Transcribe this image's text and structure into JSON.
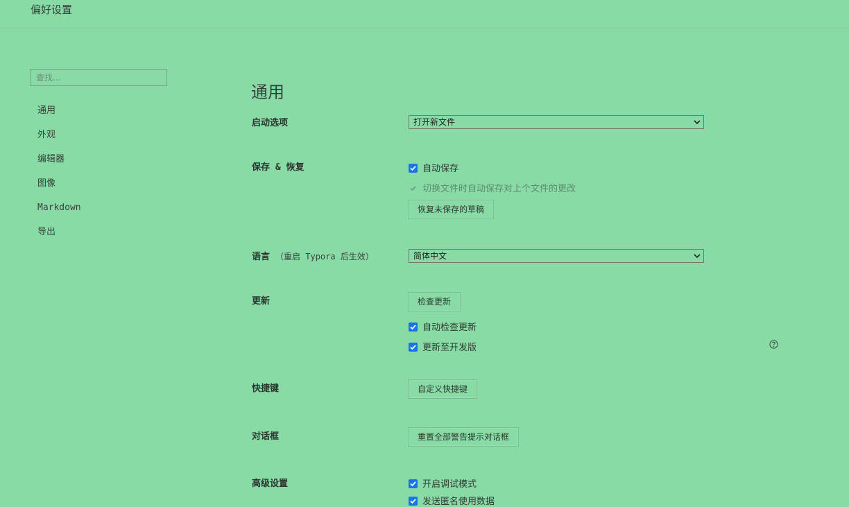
{
  "window": {
    "title": "偏好设置"
  },
  "sidebar": {
    "search_placeholder": "查找...",
    "items": [
      {
        "label": "通用"
      },
      {
        "label": "外观"
      },
      {
        "label": "编辑器"
      },
      {
        "label": "图像"
      },
      {
        "label": "Markdown"
      },
      {
        "label": "导出"
      }
    ]
  },
  "main": {
    "title": "通用",
    "startup": {
      "label": "启动选项",
      "value": "打开新文件"
    },
    "save": {
      "label": "保存 & 恢复",
      "autosave": {
        "label": "自动保存",
        "checked": true
      },
      "switch_save": {
        "label": "切换文件时自动保存对上个文件的更改",
        "checked": true,
        "disabled": true
      },
      "recover_button": "恢复未保存的草稿"
    },
    "language": {
      "label": "语言",
      "note": "（重启 Typora 后生效）",
      "value": "简体中文"
    },
    "update": {
      "label": "更新",
      "check_button": "检查更新",
      "auto_check": {
        "label": "自动检查更新",
        "checked": true
      },
      "dev_channel": {
        "label": "更新至开发版",
        "checked": true
      }
    },
    "shortcuts": {
      "label": "快捷键",
      "button": "自定义快捷键"
    },
    "dialogs": {
      "label": "对话框",
      "button": "重置全部警告提示对话框"
    },
    "advanced": {
      "label": "高级设置",
      "debug_mode": {
        "label": "开启调试模式",
        "checked": true
      },
      "anonymous_data": {
        "label": "发送匿名使用数据",
        "checked": true
      }
    }
  },
  "colors": {
    "background": "#89dba6",
    "checkbox": "#1a73e8"
  }
}
